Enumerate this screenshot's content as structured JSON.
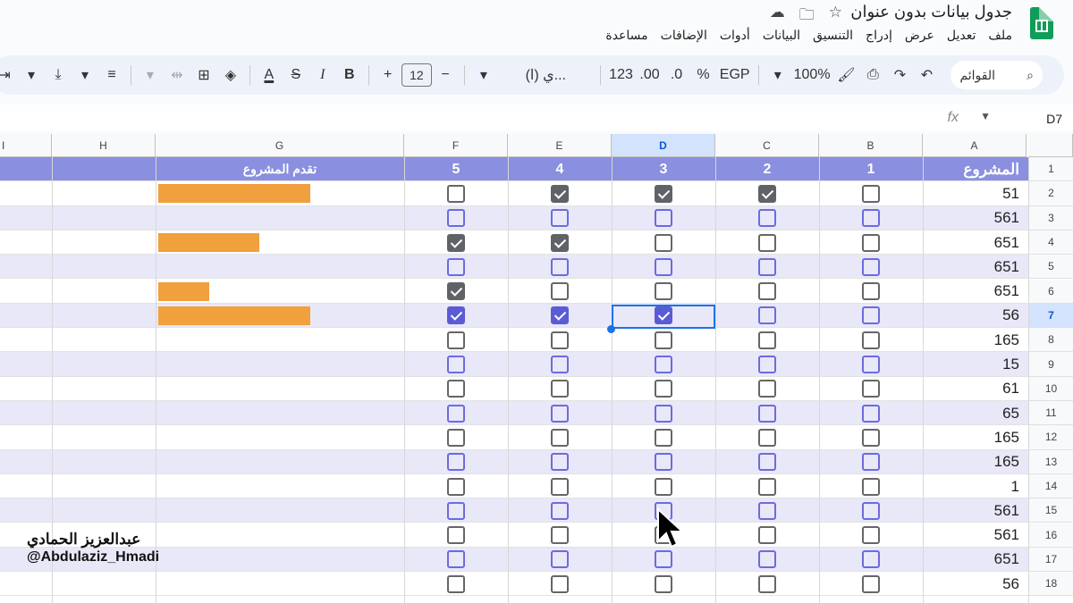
{
  "app": {
    "icon": "sheets-logo-icon"
  },
  "title": "جدول بيانات بدون عنوان",
  "title_icons": [
    "star-icon",
    "move-to-folder-icon",
    "cloud-status-icon"
  ],
  "menu": [
    "ملف",
    "تعديل",
    "عرض",
    "إدراج",
    "التنسيق",
    "البيانات",
    "أدوات",
    "الإضافات",
    "مساعدة"
  ],
  "toolbar": {
    "search": "القوائم",
    "zoom": "100%",
    "currency": "EGP",
    "percent": "%",
    "dec_decrease": ".0",
    "dec_increase": ".00",
    "number_format": "123",
    "font": "(ي (ا...",
    "font_size": "12",
    "minus": "−",
    "plus": "+",
    "bold": "B",
    "italic": "I",
    "strike": "S",
    "text_color": "A"
  },
  "formula_bar": {
    "name_box": "D7",
    "fx": "fx"
  },
  "columns": [
    "A",
    "B",
    "C",
    "D",
    "E",
    "F",
    "G",
    "H",
    "I"
  ],
  "selected_column": "D",
  "header_row": {
    "a": "المشروع",
    "b": "1",
    "c": "2",
    "d": "3",
    "e": "4",
    "f": "5",
    "g": "تقدم المشروع"
  },
  "rows": [
    {
      "num": "2",
      "a": "51",
      "checks": [
        false,
        true,
        true,
        true,
        false
      ],
      "progress": 0.6
    },
    {
      "num": "3",
      "a": "561",
      "checks": [
        false,
        false,
        false,
        false,
        false
      ],
      "progress": 0
    },
    {
      "num": "4",
      "a": "651",
      "checks": [
        false,
        false,
        false,
        true,
        true
      ],
      "progress": 0.4
    },
    {
      "num": "5",
      "a": "651",
      "checks": [
        false,
        false,
        false,
        false,
        false
      ],
      "progress": 0
    },
    {
      "num": "6",
      "a": "651",
      "checks": [
        false,
        false,
        false,
        false,
        true
      ],
      "progress": 0.2
    },
    {
      "num": "7",
      "a": "56",
      "checks": [
        false,
        false,
        true,
        true,
        true
      ],
      "progress": 0.6
    },
    {
      "num": "8",
      "a": "165",
      "checks": [
        false,
        false,
        false,
        false,
        false
      ],
      "progress": 0
    },
    {
      "num": "9",
      "a": "15",
      "checks": [
        false,
        false,
        false,
        false,
        false
      ],
      "progress": 0
    },
    {
      "num": "10",
      "a": "61",
      "checks": [
        false,
        false,
        false,
        false,
        false
      ],
      "progress": 0
    },
    {
      "num": "11",
      "a": "65",
      "checks": [
        false,
        false,
        false,
        false,
        false
      ],
      "progress": 0
    },
    {
      "num": "12",
      "a": "165",
      "checks": [
        false,
        false,
        false,
        false,
        false
      ],
      "progress": 0
    },
    {
      "num": "13",
      "a": "165",
      "checks": [
        false,
        false,
        false,
        false,
        false
      ],
      "progress": 0
    },
    {
      "num": "14",
      "a": "1",
      "checks": [
        false,
        false,
        false,
        false,
        false
      ],
      "progress": 0
    },
    {
      "num": "15",
      "a": "561",
      "checks": [
        false,
        false,
        false,
        false,
        false
      ],
      "progress": 0
    },
    {
      "num": "16",
      "a": "561",
      "checks": [
        false,
        false,
        false,
        false,
        false
      ],
      "progress": 0
    },
    {
      "num": "17",
      "a": "651",
      "checks": [
        false,
        false,
        false,
        false,
        false
      ],
      "progress": 0
    },
    {
      "num": "18",
      "a": "56",
      "checks": [
        false,
        false,
        false,
        false,
        false
      ],
      "progress": 0
    }
  ],
  "selected_row": "7",
  "colors": {
    "header_row": "#8a8fe0",
    "alt_row": "#e8e8f8",
    "progress_bar": "#f0a03c",
    "selection": "#1a73e8"
  },
  "watermark": {
    "name": "عبدالعزيز الحمادي",
    "handle": "@Abdulaziz_Hmadi"
  }
}
